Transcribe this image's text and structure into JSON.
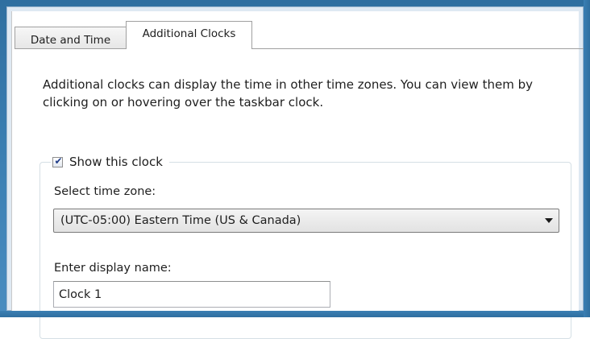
{
  "tabs": [
    {
      "label": "Date and Time",
      "selected": false
    },
    {
      "label": "Additional Clocks",
      "selected": true
    }
  ],
  "description": "Additional clocks can display the time in other time zones. You can view them by clicking on or hovering over the taskbar clock.",
  "clock_group": {
    "show_label": "Show this clock",
    "show_checked": true,
    "timezone_label": "Select time zone:",
    "timezone_value": "(UTC-05:00) Eastern Time (US & Canada)",
    "display_name_label": "Enter display name:",
    "display_name_value": "Clock 1"
  },
  "icons": {
    "checkbox": "checkmark-icon",
    "dropdown": "chevron-down-icon"
  },
  "colors": {
    "frame_border": "#3b7fb3",
    "checkmark": "#1f3c88"
  }
}
